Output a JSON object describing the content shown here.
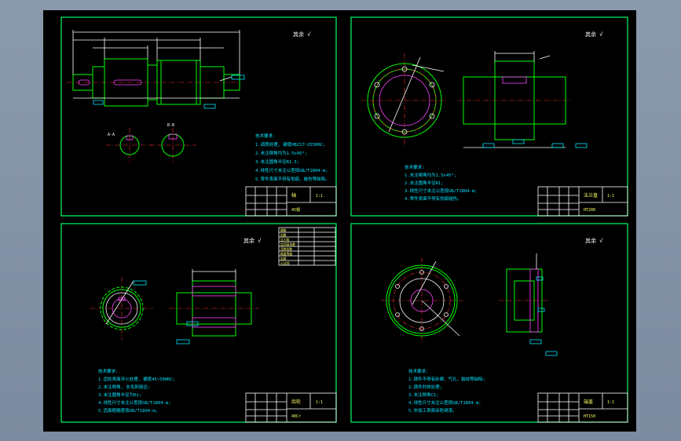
{
  "window": {
    "background": "#000000",
    "frame_color": "#00ff66",
    "desktop_color": "#8b99ad"
  },
  "sheets": [
    {
      "id": "shaft",
      "roughness": "其余 √",
      "notes": [
        "技术要求:",
        "1.调质处理, 硬度HB217~255HRC;",
        "2.未注倒角均为1.5x45°;",
        "3.未注圆角半径R1.5;",
        "4.线性尺寸未注公差按GB/T1804-m;",
        "5.零件表面不得有划痕、碰伤等缺陷。"
      ],
      "title": "轴",
      "material": "45钢",
      "scale": "1:1"
    },
    {
      "id": "flange",
      "roughness": "其余 √",
      "notes": [
        "技术要求:",
        "1.未注倒角均为1.5x45°;",
        "2.未注圆角半径R1;",
        "3.线性尺寸未注公差按GB/T1804-m;",
        "4.零件表面不得有划痕碰伤。"
      ],
      "title": "法兰盘",
      "material": "HT200",
      "scale": "1:1"
    },
    {
      "id": "gear",
      "roughness": "其余 √",
      "notes": [
        "技术要求:",
        "1.齿轮表面淬火处理, 硬度45~50HRC;",
        "2.未注倒角, 去毛刺锐边;",
        "3.未注圆角半径为R1;",
        "4.线性尺寸未注公差按GB/T1804-m;",
        "5.齿面粗糙度按GB/T1804-m。"
      ],
      "title": "齿轮",
      "material": "40Cr",
      "scale": "1:1",
      "param_table": [
        "模数",
        "齿数",
        "压力角",
        "齿顶高系数",
        "顶隙系数",
        "精度等级",
        "齿厚",
        "公法线"
      ]
    },
    {
      "id": "cover",
      "roughness": "其余 √",
      "notes": [
        "技术要求:",
        "1.铸件不得有砂眼、气孔、裂纹等缺陷;",
        "2.铸件时效处理;",
        "3.未注倒角C1;",
        "4.线性尺寸未注公差按GB/T1804-m;",
        "5.非加工表面涂防锈漆。"
      ],
      "title": "端盖",
      "material": "HT150",
      "scale": "1:1"
    }
  ],
  "labels": {
    "section_a": "A-A",
    "section_b": "B-B"
  }
}
